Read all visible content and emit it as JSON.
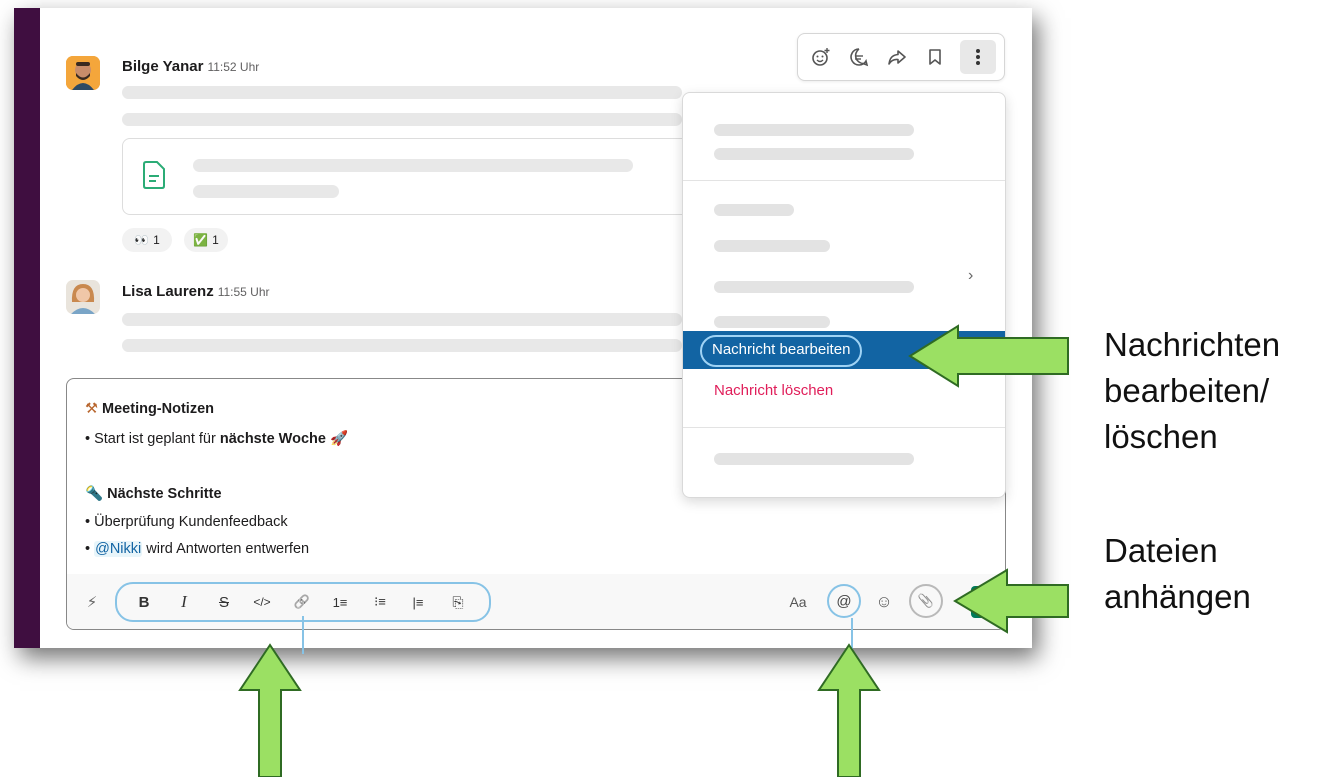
{
  "messages": [
    {
      "author": "Bilge Yanar",
      "time": "11:52 Uhr"
    },
    {
      "author": "Lisa Laurenz",
      "time": "11:55 Uhr"
    }
  ],
  "reactions": [
    {
      "emoji": "👀",
      "count": "1"
    },
    {
      "emoji": "✅",
      "count": "1"
    }
  ],
  "menu": {
    "edit_label": "Nachricht bearbeiten",
    "delete_label": "Nachricht löschen",
    "chevron": "›"
  },
  "composer": {
    "heading1_emoji": "⚒",
    "heading1": "Meeting-Notizen",
    "line1_prefix": "• Start ist geplant für ",
    "line1_bold": "nächste Woche",
    "line1_emoji": "🚀",
    "heading2_emoji": "🔦",
    "heading2": "Nächste Schritte",
    "line2": "• Überprüfung Kundenfeedback",
    "line3_bullet": "• ",
    "line3_mention": "@Nikki",
    "line3_rest": " wird Antworten entwerfen"
  },
  "toolbar": {
    "shortcuts_icon": "⚡",
    "bold": "B",
    "italic": "I",
    "strike": "S",
    "code": "</>",
    "link": "🔗",
    "ordered_list": "1≡",
    "bullet_list": "⁝≡",
    "blockquote": "|≡",
    "code_block": "⎘",
    "text_format": "Aa",
    "mention": "@",
    "emoji": "☺",
    "attach": "📎"
  },
  "callouts": {
    "edit_delete": [
      "Nachrichten",
      "bearbeiten/",
      "löschen"
    ],
    "attach_files": [
      "Dateien",
      "anhängen"
    ]
  },
  "colors": {
    "sidebar": "#3f0e40",
    "highlight": "#1264a3",
    "delete": "#e01e5a",
    "arrow_fill": "#9be063",
    "arrow_stroke": "#2f6b23",
    "focus_ring": "#87c3e6"
  },
  "icons": {
    "action_bar": [
      "add-reaction-icon",
      "reply-in-thread-icon",
      "forward-icon",
      "bookmark-icon",
      "more-actions-icon"
    ],
    "file": "document-icon"
  }
}
